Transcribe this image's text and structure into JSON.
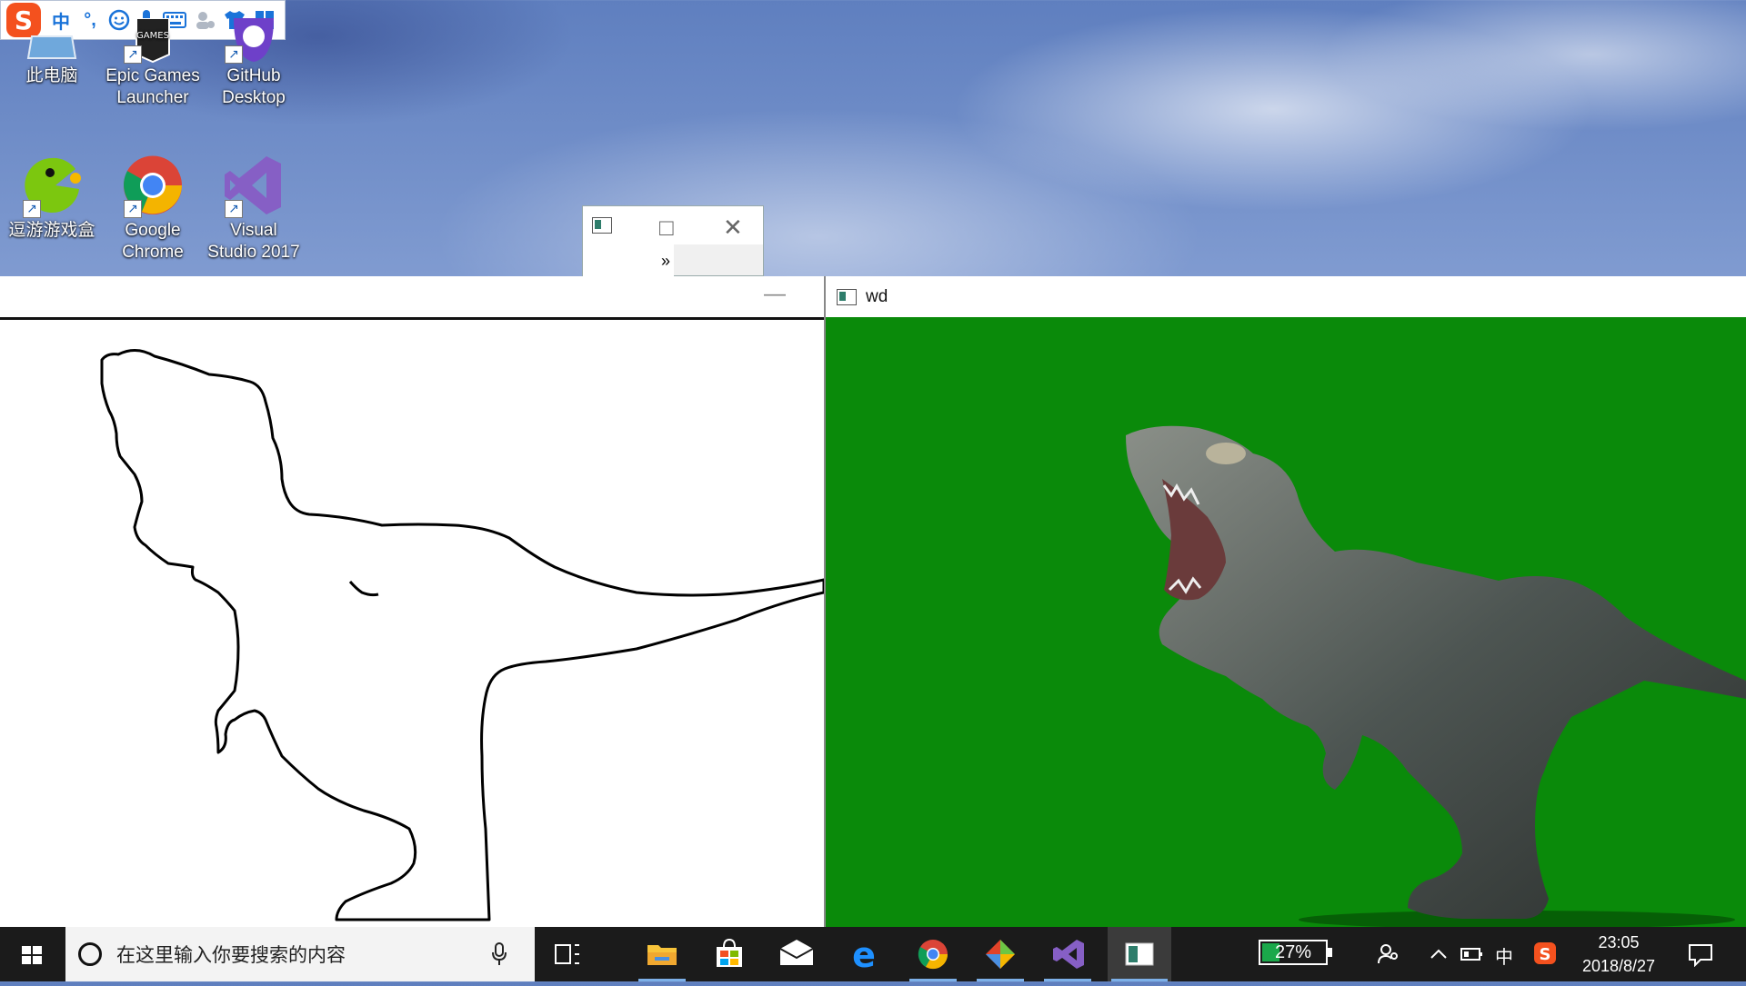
{
  "ime": {
    "mode_label": "中",
    "punct_label": "°,"
  },
  "desktop": {
    "icons": [
      {
        "label": "此电脑"
      },
      {
        "label": "Epic Games\nLauncher"
      },
      {
        "label": "GitHub\nDesktop"
      },
      {
        "label": "逗游游戏盒"
      },
      {
        "label": "Google\nChrome"
      },
      {
        "label": "Visual\nStudio 2017"
      }
    ]
  },
  "small_window": {
    "chevron": "»"
  },
  "right_window": {
    "title": "wd"
  },
  "taskbar": {
    "search_placeholder": "在这里输入你要搜索的内容",
    "battery_percent": 27,
    "battery_label": "27%",
    "ime_indicator": "中",
    "time": "23:05",
    "date": "2018/8/27"
  },
  "colors": {
    "green_screen": "#0a8a0a",
    "taskbar": "#1b1b1b",
    "battery_fill": "#1aa84a"
  }
}
